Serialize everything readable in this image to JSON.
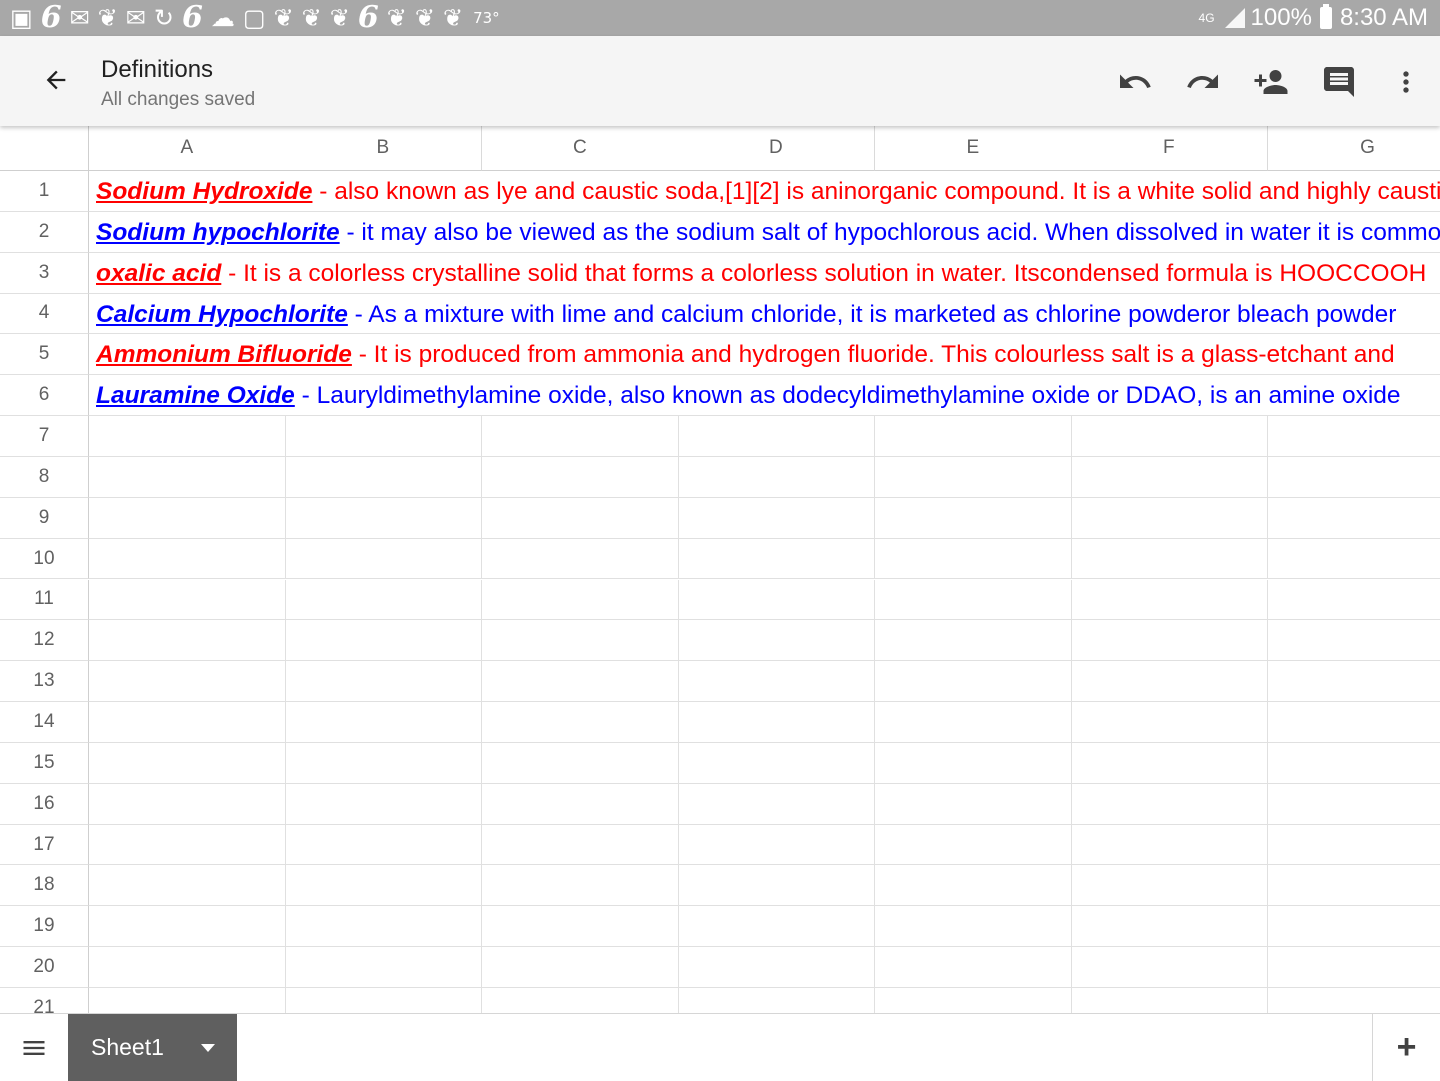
{
  "status_bar": {
    "temperature": "73°",
    "network": "4G",
    "battery": "100%",
    "time": "8:30 AM",
    "icons": [
      "gallery-icon",
      "channel-6-icon",
      "mail-icon",
      "twitter-icon",
      "email-icon",
      "sync-icon",
      "channel-6-icon",
      "cloud-icon",
      "instagram-icon",
      "twitter-icon",
      "twitter-icon",
      "twitter-icon",
      "channel-6-icon",
      "twitter-icon",
      "twitter-icon",
      "twitter-icon"
    ]
  },
  "app_bar": {
    "title": "Definitions",
    "subtitle": "All changes saved",
    "actions": [
      "undo-icon",
      "redo-icon",
      "add-person-icon",
      "comment-icon",
      "more-vert-icon"
    ]
  },
  "grid": {
    "columns": [
      "A",
      "B",
      "C",
      "D",
      "E",
      "F",
      "G"
    ],
    "row_numbers": [
      "1",
      "2",
      "3",
      "4",
      "5",
      "6",
      "7",
      "8",
      "9",
      "10",
      "11",
      "12",
      "13",
      "14",
      "15",
      "16",
      "17",
      "18",
      "19",
      "20",
      "21"
    ],
    "entries": [
      {
        "row": "1",
        "term": "Sodium Hydroxide",
        "definition": " - also known as lye and caustic soda,[1][2] is aninorganic compound. It is a white solid and highly caustic",
        "color": "#ff0000"
      },
      {
        "row": "2",
        "term": "Sodium hypochlorite",
        "definition": " - it may also be viewed as the sodium salt of hypochlorous acid. When dissolved in water it is commonly",
        "color": "#0000ff"
      },
      {
        "row": "3",
        "term": "oxalic acid",
        "definition": " - It is a colorless crystalline solid that forms a colorless solution in water. Itscondensed formula is HOOCCOOH",
        "color": "#ff0000"
      },
      {
        "row": "4",
        "term": "Calcium Hypochlorite",
        "definition": " - As a mixture with lime and calcium chloride, it is marketed as chlorine powderor bleach powder",
        "color": "#0000ff"
      },
      {
        "row": "5",
        "term": "Ammonium Bifluoride",
        "definition": " - It is produced from ammonia and hydrogen fluoride. This colourless salt is a glass-etchant and",
        "color": "#ff0000"
      },
      {
        "row": "6",
        "term": "Lauramine Oxide",
        "definition": " - Lauryldimethylamine oxide, also known as dodecyldimethylamine oxide or DDAO,  is an amine oxide",
        "color": "#0000ff"
      }
    ]
  },
  "bottom_bar": {
    "sheet_name": "Sheet1",
    "add_label": "+"
  }
}
